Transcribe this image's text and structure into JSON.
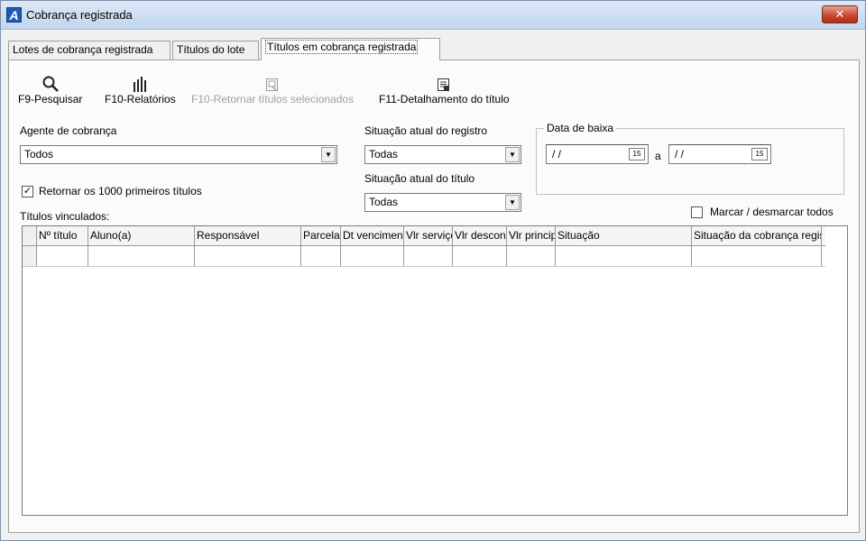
{
  "window": {
    "title": "Cobrança registrada",
    "close_label": "✕"
  },
  "tabs": [
    {
      "label": "Lotes de cobrança registrada"
    },
    {
      "label": "Títulos do lote"
    },
    {
      "label": "Títulos em cobrança registrada"
    }
  ],
  "toolbar": {
    "search_label": "F9-Pesquisar",
    "reports_label": "F10-Relatórios",
    "return_label": "F10-Retornar títulos selecionados",
    "detail_label": "F11-Detalhamento do título"
  },
  "filters": {
    "agent_label": "Agente de cobrança",
    "agent_value": "Todos",
    "reg_status_label": "Situação atual do registro",
    "reg_status_value": "Todas",
    "title_status_label": "Situação atual do título",
    "title_status_value": "Todas",
    "date_group_label": "Data de baixa",
    "date_from": "/ /",
    "date_sep": "a",
    "date_to": "/ /",
    "calendar_glyph": "15",
    "return_first_label": "Retornar os 1000 primeiros títulos",
    "return_first_checked": "✓",
    "toggle_all_label": "Marcar / desmarcar todos"
  },
  "grid": {
    "caption": "Títulos vinculados:",
    "columns": [
      "Nº título",
      "Aluno(a)",
      "Responsável",
      "Parcela",
      "Dt vencimento",
      "Vlr serviço",
      "Vlr desconto",
      "Vlr principal",
      "Situação",
      "Situação da cobrança registrada"
    ]
  }
}
